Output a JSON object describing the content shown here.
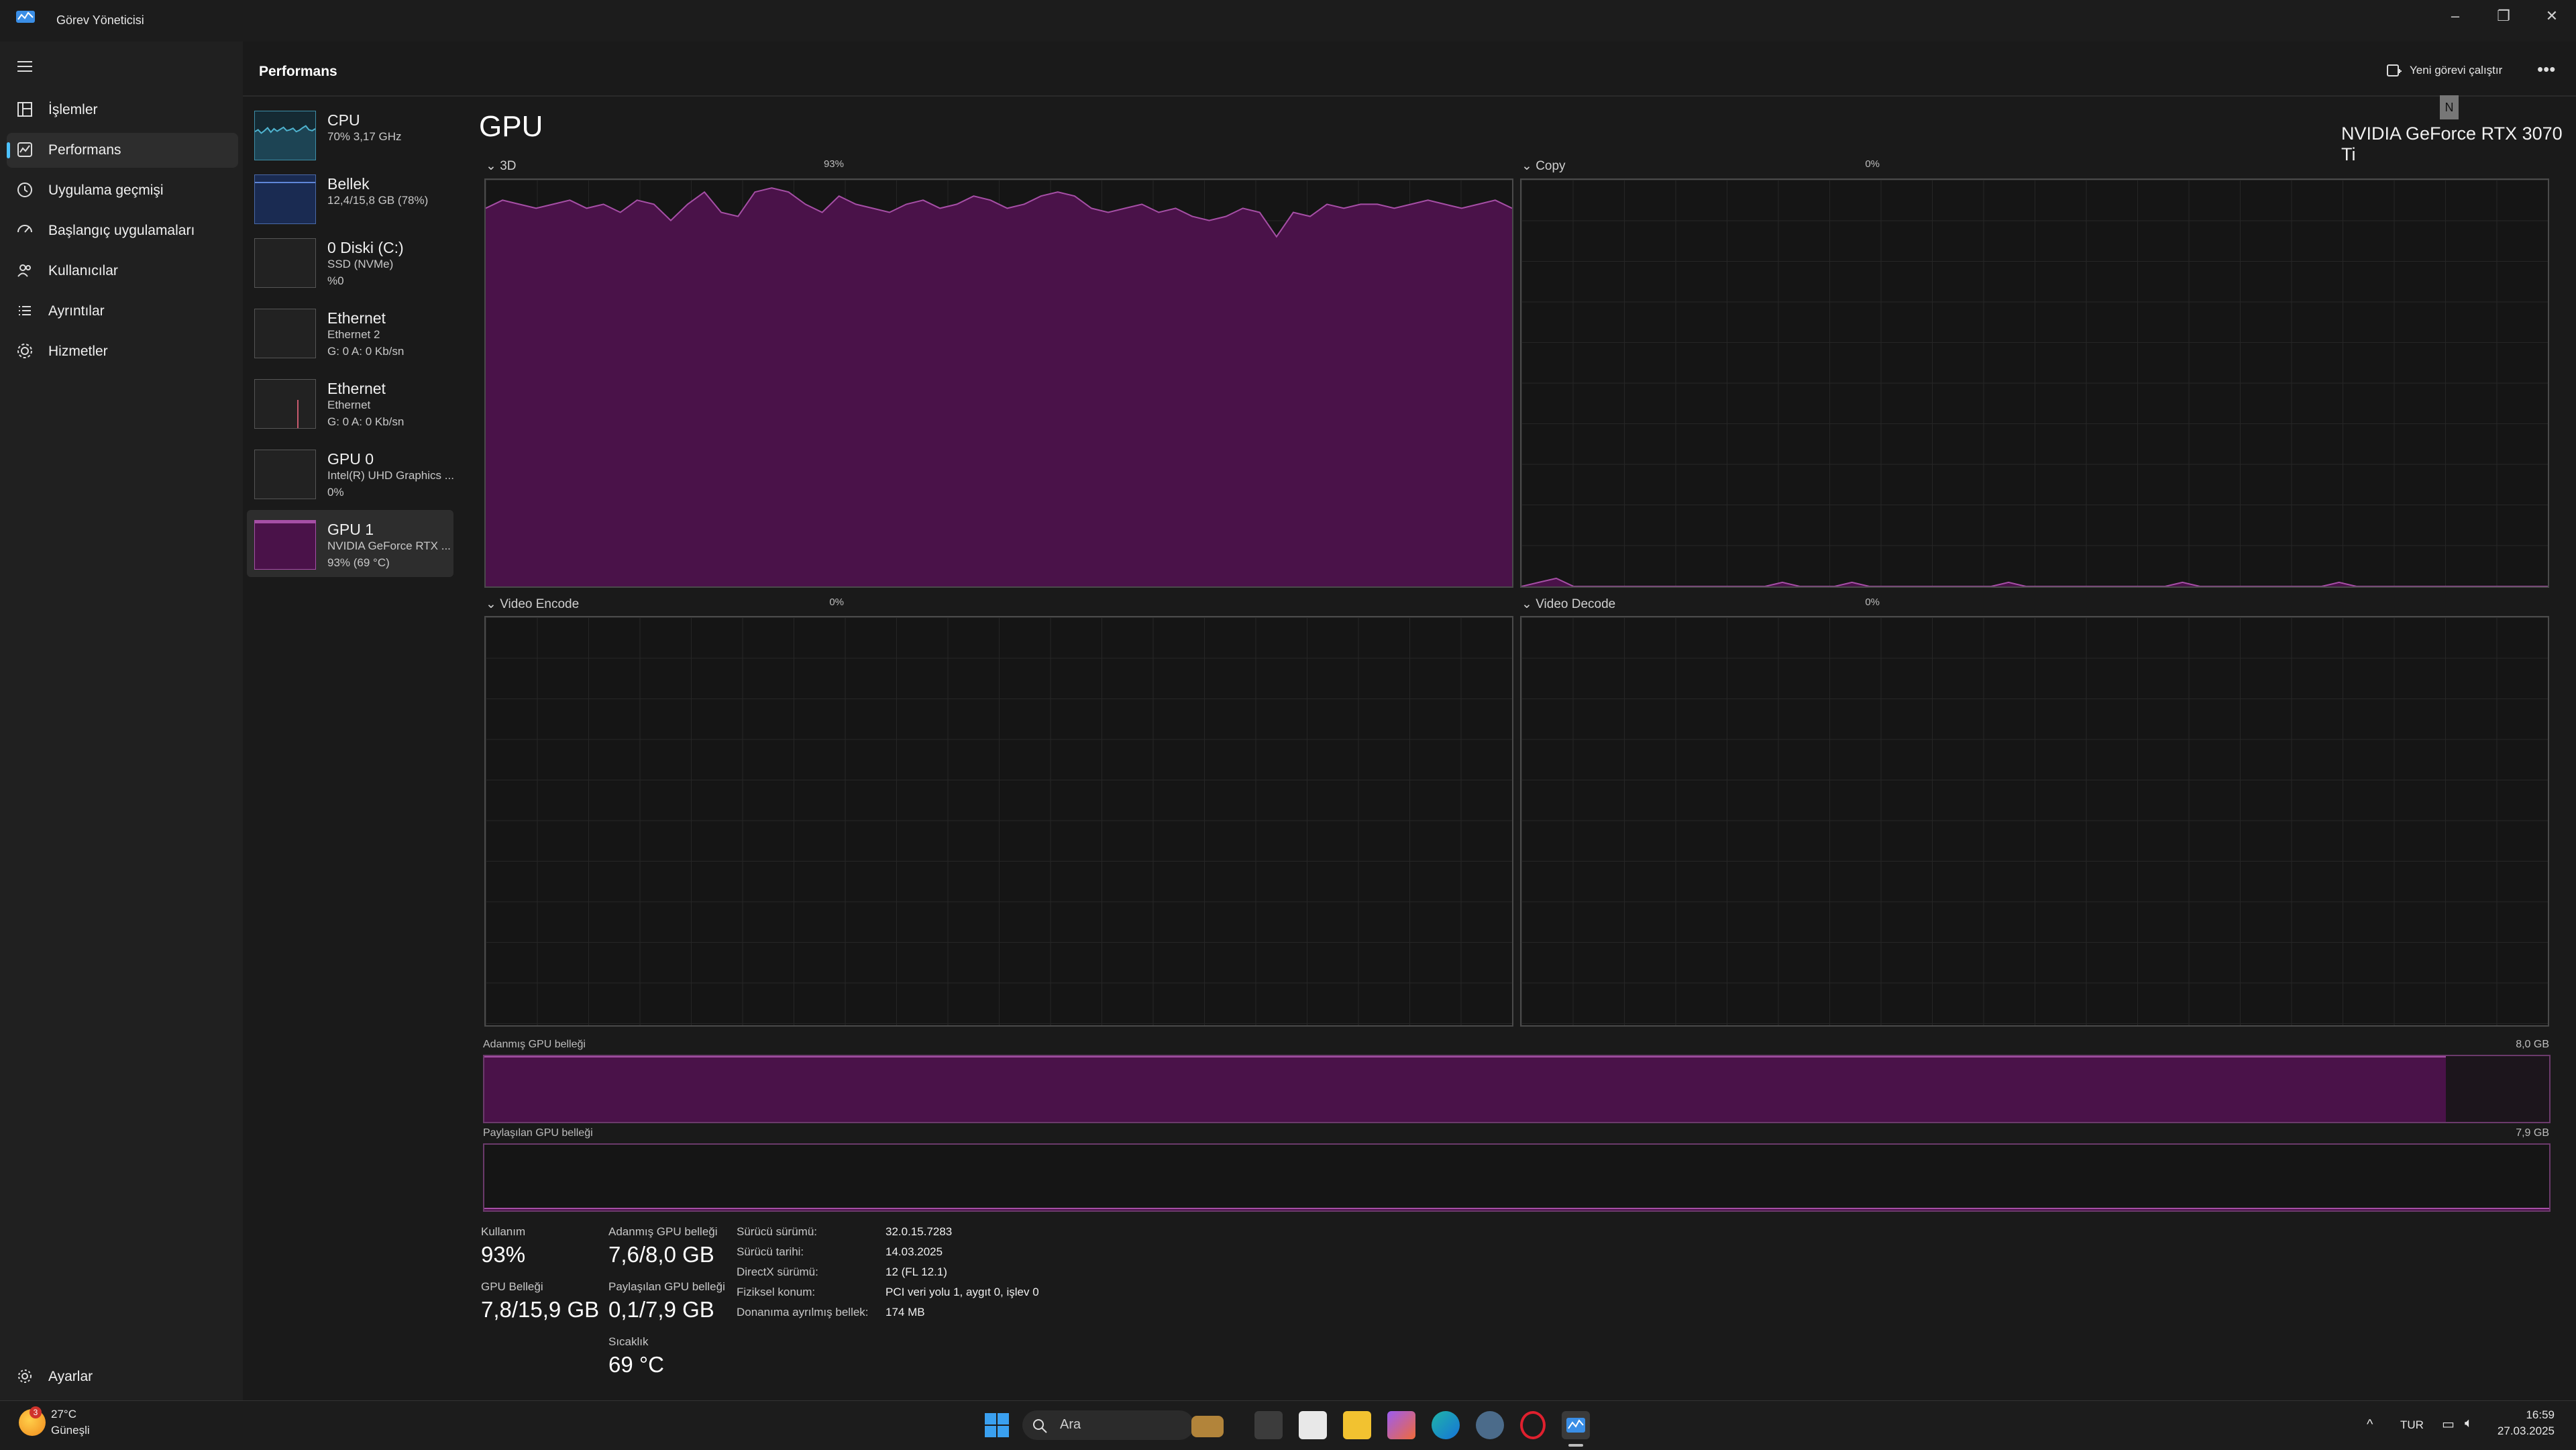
{
  "app": {
    "title": "Görev Yöneticisi"
  },
  "nav": {
    "items": [
      {
        "label": "İşlemler",
        "icon": "processes-icon"
      },
      {
        "label": "Performans",
        "icon": "performance-icon"
      },
      {
        "label": "Uygulama geçmişi",
        "icon": "history-icon"
      },
      {
        "label": "Başlangıç uygulamaları",
        "icon": "startup-icon"
      },
      {
        "label": "Kullanıcılar",
        "icon": "users-icon"
      },
      {
        "label": "Ayrıntılar",
        "icon": "details-icon"
      },
      {
        "label": "Hizmetler",
        "icon": "services-icon"
      }
    ],
    "settings": "Ayarlar"
  },
  "header": {
    "title": "Performans",
    "new_task": "Yeni görevi çalıştır"
  },
  "resources": [
    {
      "name": "CPU",
      "sub1": "70% 3,17 GHz",
      "sub2": ""
    },
    {
      "name": "Bellek",
      "sub1": "12,4/15,8 GB (78%)",
      "sub2": ""
    },
    {
      "name": "0 Diski (C:)",
      "sub1": "SSD (NVMe)",
      "sub2": "%0"
    },
    {
      "name": "Ethernet",
      "sub1": "Ethernet 2",
      "sub2": "G: 0 A: 0 Kb/sn"
    },
    {
      "name": "Ethernet",
      "sub1": "Ethernet",
      "sub2": "G: 0 A: 0 Kb/sn"
    },
    {
      "name": "GPU 0",
      "sub1": "Intel(R) UHD Graphics ...",
      "sub2": "0%"
    },
    {
      "name": "GPU 1",
      "sub1": "NVIDIA GeForce RTX ...",
      "sub2": "93% (69 °C)"
    }
  ],
  "main": {
    "heading": "GPU",
    "model": "NVIDIA GeForce RTX 3070 Ti",
    "badge": "N",
    "engines": [
      {
        "name": "3D",
        "percent": "93%"
      },
      {
        "name": "Copy",
        "percent": "0%"
      },
      {
        "name": "Video Encode",
        "percent": "0%"
      },
      {
        "name": "Video Decode",
        "percent": "0%"
      }
    ],
    "dedicated": {
      "label": "Adanmış GPU belleği",
      "max": "8,0 GB",
      "fill_fraction": 0.95
    },
    "shared": {
      "label": "Paylaşılan GPU belleği",
      "max": "7,9 GB",
      "fill_fraction": 0.01
    }
  },
  "stats": {
    "usage_label": "Kullanım",
    "usage": "93%",
    "ded_label": "Adanmış GPU belleği",
    "ded": "7,6/8,0 GB",
    "gpumem_label": "GPU Belleği",
    "gpumem": "7,8/15,9 GB",
    "shared_label": "Paylaşılan GPU belleği",
    "shared": "0,1/7,9 GB",
    "temp_label": "Sıcaklık",
    "temp": "69 °C"
  },
  "info": [
    {
      "label": "Sürücü sürümü:",
      "value": "32.0.15.7283"
    },
    {
      "label": "Sürücü tarihi:",
      "value": "14.03.2025"
    },
    {
      "label": "DirectX sürümü:",
      "value": "12 (FL 12.1)"
    },
    {
      "label": "Fiziksel konum:",
      "value": "PCI veri yolu 1, aygıt 0, işlev 0"
    },
    {
      "label": "Donanıma ayrılmış bellek:",
      "value": "174 MB"
    }
  ],
  "taskbar": {
    "weather_temp": "27°C",
    "weather_desc": "Güneşli",
    "weather_badge": "3",
    "search": "Ara",
    "lang": "TUR",
    "time": "16:59",
    "date": "27.03.2025"
  },
  "colors": {
    "gpu_fill": "#4a1249",
    "gpu_line": "#a64fa6",
    "accent": "#4cc2ff"
  },
  "series": {
    "cpu_thumb": [
      58,
      62,
      55,
      60,
      66,
      57,
      64,
      59,
      63,
      67,
      60,
      62,
      65,
      58,
      61,
      66,
      70,
      62,
      60,
      64
    ],
    "gpu3d": [
      93,
      95,
      94,
      93,
      94,
      95,
      93,
      94,
      92,
      95,
      94,
      90,
      94,
      97,
      92,
      91,
      97,
      98,
      97,
      94,
      92,
      96,
      94,
      93,
      92,
      94,
      95,
      93,
      94,
      96,
      95,
      93,
      94,
      96,
      97,
      96,
      93,
      92,
      93,
      94,
      92,
      93,
      91,
      90,
      91,
      93,
      92,
      86,
      92,
      91,
      94,
      93,
      94,
      94,
      93,
      94,
      95,
      94,
      93,
      94,
      95,
      93
    ],
    "copy": [
      0,
      1,
      2,
      0,
      0,
      0,
      0,
      0,
      0,
      0,
      0,
      0,
      0,
      0,
      0,
      1,
      0,
      0,
      0,
      1,
      0,
      0,
      0,
      0,
      0,
      0,
      0,
      0,
      1,
      0,
      0,
      0,
      0,
      0,
      0,
      0,
      0,
      0,
      1,
      0,
      0,
      0,
      0,
      0,
      0,
      0,
      0,
      1,
      0,
      0,
      0,
      0,
      0,
      0,
      0,
      0,
      0,
      0,
      0,
      0
    ]
  }
}
